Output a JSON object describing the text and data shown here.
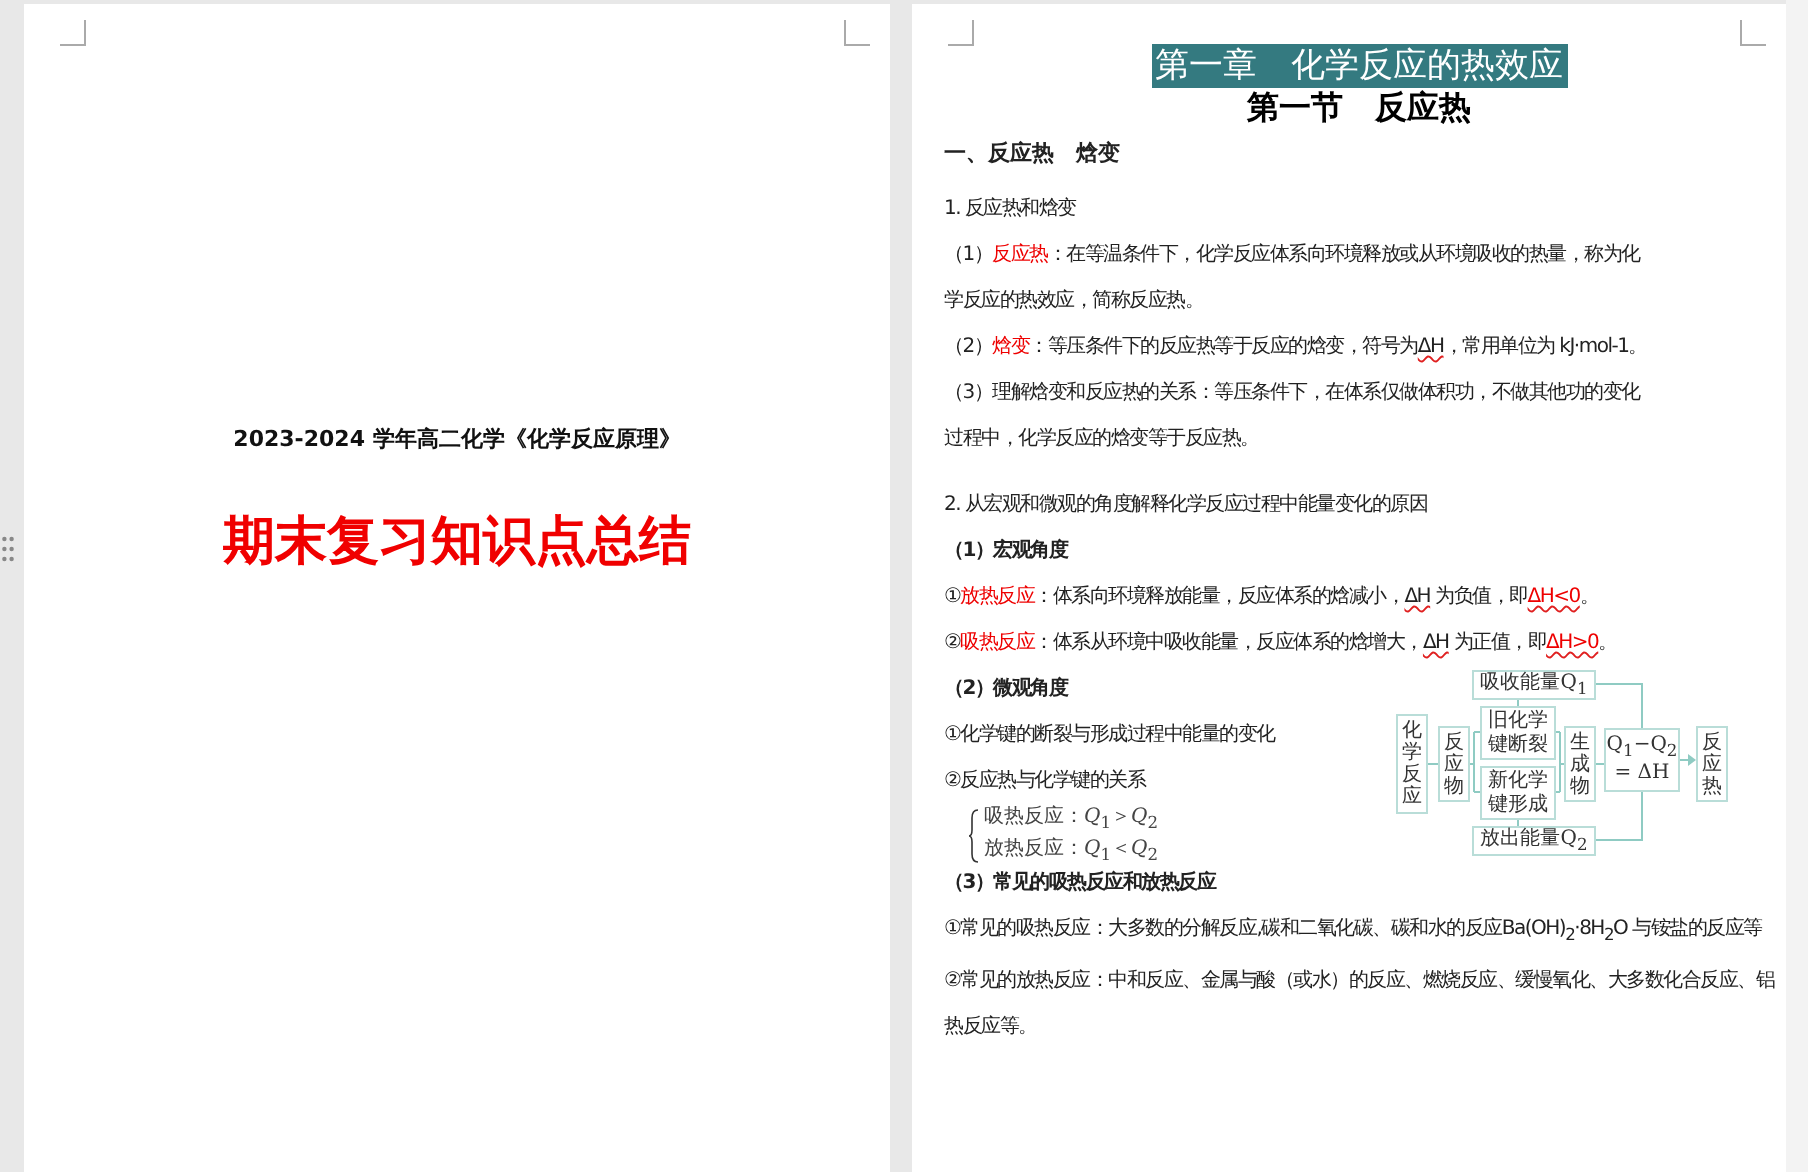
{
  "cover_page": {
    "subtitle": "2023-2024 学年高二化学《化学反应原理》",
    "title": "期末复习知识点总结"
  },
  "content_page": {
    "chapter_title": "第一章　化学反应的热效应",
    "section_title": "第一节　反应热",
    "heading": "一、反应热　焓变",
    "part_1": [
      {
        "kind": "body",
        "segments": [
          {
            "text": "1. 反应热和焓变",
            "emphasis": false,
            "flagged": false
          }
        ]
      },
      {
        "kind": "body",
        "segments": [
          {
            "text": "（1）",
            "emphasis": false,
            "flagged": false
          },
          {
            "text": "反应热",
            "emphasis": true,
            "flagged": false
          },
          {
            "text": "：在等温条件下，化学反应体系向环境释放或从环境吸收的热量，称为化",
            "emphasis": false,
            "flagged": false
          }
        ]
      },
      {
        "kind": "body",
        "segments": [
          {
            "text": "学反应的热效应，简称反应热。",
            "emphasis": false,
            "flagged": false
          }
        ]
      },
      {
        "kind": "body",
        "segments": [
          {
            "text": "（2）",
            "emphasis": false,
            "flagged": false
          },
          {
            "text": "焓变",
            "emphasis": true,
            "flagged": false
          },
          {
            "text": "：等压条件下的反应热等于反应的焓变，符号为",
            "emphasis": false,
            "flagged": false
          },
          {
            "text": "ΔH",
            "emphasis": false,
            "flagged": true
          },
          {
            "text": "，常用单位为 kJ·mol-1。",
            "emphasis": false,
            "flagged": false
          }
        ]
      },
      {
        "kind": "body",
        "segments": [
          {
            "text": "（3）理解焓变和反应热的关系：等压条件下，在体系仅做体积功，不做其他功的变化",
            "emphasis": false,
            "flagged": false
          }
        ]
      },
      {
        "kind": "body",
        "segments": [
          {
            "text": "过程中，化学反应的焓变等于反应热。",
            "emphasis": false,
            "flagged": false
          }
        ]
      }
    ],
    "part_2": [
      {
        "kind": "body",
        "segments": [
          {
            "text": "2. 从宏观和微观的角度解释化学反应过程中能量变化的原因",
            "emphasis": false,
            "flagged": false
          }
        ]
      },
      {
        "kind": "subheading",
        "segments": [
          {
            "text": "（1）宏观角度",
            "emphasis": false,
            "flagged": false
          }
        ]
      },
      {
        "kind": "body",
        "segments": [
          {
            "text": "①",
            "emphasis": false,
            "flagged": false
          },
          {
            "text": "放热反应",
            "emphasis": true,
            "flagged": false
          },
          {
            "text": "：体系向环境释放能量，反应体系的焓减小，",
            "emphasis": false,
            "flagged": false
          },
          {
            "text": "ΔH",
            "emphasis": false,
            "flagged": true
          },
          {
            "text": " 为负值，即",
            "emphasis": false,
            "flagged": false
          },
          {
            "text": "ΔH<0",
            "emphasis": true,
            "flagged": true
          },
          {
            "text": "。",
            "emphasis": false,
            "flagged": false
          }
        ]
      },
      {
        "kind": "body",
        "segments": [
          {
            "text": "②",
            "emphasis": false,
            "flagged": false
          },
          {
            "text": "吸热反应",
            "emphasis": true,
            "flagged": false
          },
          {
            "text": "：体系从环境中吸收能量，反应体系的焓增大，",
            "emphasis": false,
            "flagged": false
          },
          {
            "text": "ΔH",
            "emphasis": false,
            "flagged": true
          },
          {
            "text": " 为正值，即",
            "emphasis": false,
            "flagged": false
          },
          {
            "text": "ΔH>0",
            "emphasis": true,
            "flagged": true
          },
          {
            "text": "。",
            "emphasis": false,
            "flagged": false
          }
        ]
      }
    ],
    "micro": {
      "heading": "（2）微观角度",
      "lines": [
        "①化学键的断裂与形成过程中能量的变化",
        "②反应热与化学键的关系"
      ],
      "relations": [
        "吸热反应：*Q*$_{1}$＞*Q*$_{2}$",
        "放热反应：*Q*$_{1}$＜*Q*$_{2}$"
      ],
      "diagram_nodes": [
        "化学反应",
        "反应物",
        "吸收能量Q$_{1}$",
        "旧化学键断裂",
        "新化学键形成",
        "生成物",
        "Q$_{1}$−Q$_{2}$= ΔH",
        "反应热",
        "放出能量Q$_{2}$"
      ]
    },
    "part_3": [
      {
        "kind": "subheading",
        "segments": [
          {
            "text": "（3）常见的吸热反应和放热反应",
            "emphasis": false,
            "flagged": false
          }
        ]
      },
      {
        "kind": "body",
        "segments": [
          {
            "text": "①常见的吸热反应：大多数的分解反应,碳和二氧化碳、碳和水的反应Ba(OH)$_{2}$·8H$_{2}$O 与铵盐的反应等",
            "emphasis": false,
            "flagged": false
          }
        ]
      },
      {
        "kind": "body",
        "segments": [
          {
            "text": "②常见的放热反应：中和反应、金属与酸（或水）的反应、燃烧反应、缓慢氧化、大多数化合反应、铝",
            "emphasis": false,
            "flagged": false
          }
        ]
      },
      {
        "kind": "body",
        "segments": [
          {
            "text": "热反应等。",
            "emphasis": false,
            "flagged": false
          }
        ]
      }
    ]
  }
}
